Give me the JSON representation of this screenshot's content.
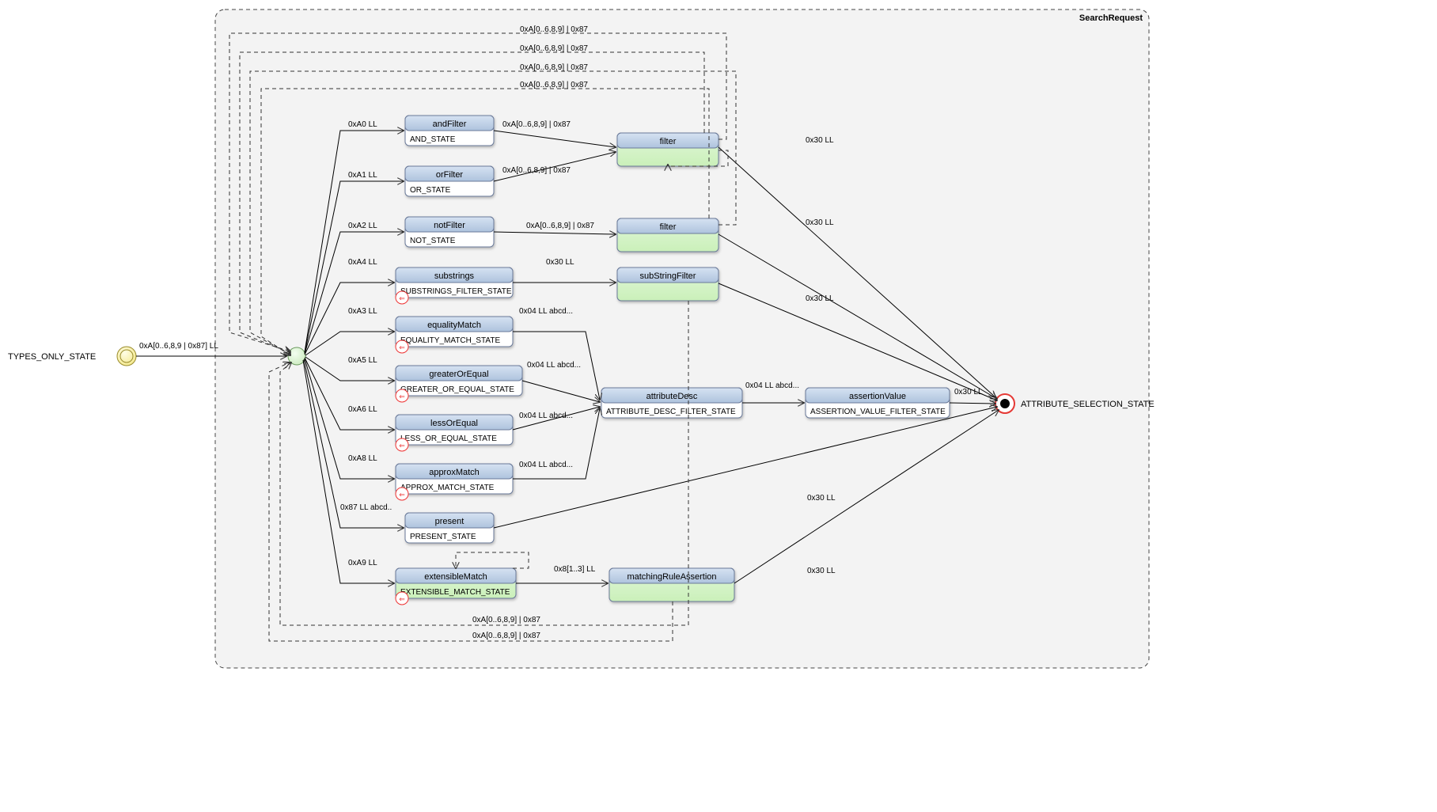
{
  "container": {
    "title": "SearchRequest"
  },
  "startState": {
    "label": "TYPES_ONLY_STATE"
  },
  "startEdge": {
    "label": "0xA[0..6,8,9 | 0x87] LL"
  },
  "endState": {
    "label": "ATTRIBUTE_SELECTION_STATE"
  },
  "nodes": {
    "andFilter": {
      "title": "andFilter",
      "sub": "AND_STATE"
    },
    "orFilter": {
      "title": "orFilter",
      "sub": "OR_STATE"
    },
    "notFilter": {
      "title": "notFilter",
      "sub": "NOT_STATE"
    },
    "substrings": {
      "title": "substrings",
      "sub": "SUBSTRINGS_FILTER_STATE"
    },
    "equalityMatch": {
      "title": "equalityMatch",
      "sub": "EQUALITY_MATCH_STATE"
    },
    "greaterOrEqual": {
      "title": "greaterOrEqual",
      "sub": "GREATER_OR_EQUAL_STATE"
    },
    "lessOrEqual": {
      "title": "lessOrEqual",
      "sub": "LESS_OR_EQUAL_STATE"
    },
    "approxMatch": {
      "title": "approxMatch",
      "sub": "APPROX_MATCH_STATE"
    },
    "present": {
      "title": "present",
      "sub": "PRESENT_STATE"
    },
    "extensibleMatch": {
      "title": "extensibleMatch",
      "sub": "EXTENSIBLE_MATCH_STATE"
    },
    "filter1": {
      "title": "filter"
    },
    "filter2": {
      "title": "filter"
    },
    "subStringFilter": {
      "title": "subStringFilter"
    },
    "matchingRuleAssertion": {
      "title": "matchingRuleAssertion"
    },
    "attributeDesc": {
      "title": "attributeDesc",
      "sub": "ATTRIBUTE_DESC_FILTER_STATE"
    },
    "assertionValue": {
      "title": "assertionValue",
      "sub": "ASSERTION_VALUE_FILTER_STATE"
    }
  },
  "edgeLabels": {
    "toAnd": "0xA0 LL",
    "toOr": "0xA1 LL",
    "toNot": "0xA2 LL",
    "toSub": "0xA4 LL",
    "toEq": "0xA3 LL",
    "toGe": "0xA5 LL",
    "toLe": "0xA6 LL",
    "toApprox": "0xA8 LL",
    "toPresent": "0x87 LL abcd..",
    "toExt": "0xA9 LL",
    "andToFilter": "0xA[0..6,8,9] | 0x87",
    "orToFilter": "0xA[0..6,8,9] | 0x87",
    "notToFilter": "0xA[0..6,8,9] | 0x87",
    "subToSub": "0x30 LL",
    "eqToAttr": "0x04 LL abcd...",
    "geToAttr": "0x04 LL abcd...",
    "leToAttr": "0x04 LL abcd...",
    "apToAttr": "0x04 LL abcd...",
    "attrToAssert": "0x04 LL abcd...",
    "extToMatch": "0x8[1..3] LL",
    "back1": "0xA[0..6,8,9] | 0x87",
    "back2": "0xA[0..6,8,9] | 0x87",
    "back3": "0xA[0..6,8,9] | 0x87",
    "back4": "0xA[0..6,8,9] | 0x87",
    "back5": "0xA[0..6,8,9] | 0x87",
    "back6": "0xA[0..6,8,9] | 0x87",
    "filter1ToEnd": "0x30 LL",
    "filter2ToEnd": "0x30 LL",
    "subFilterToEnd": "0x30 LL",
    "assertToEnd": "0x30 LL",
    "presentToEnd": "0x30 LL",
    "matchToEnd": "0x30 LL"
  }
}
